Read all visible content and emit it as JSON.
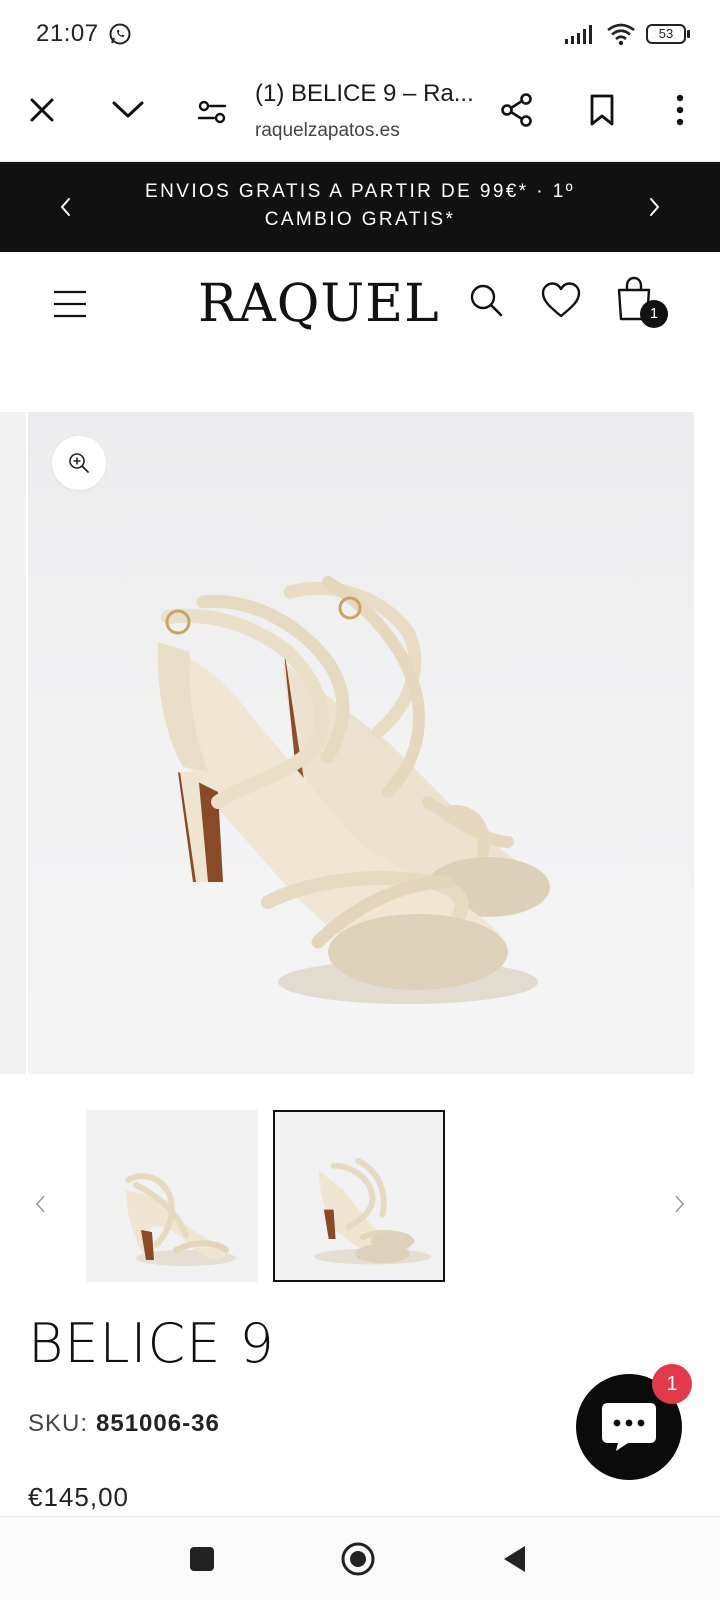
{
  "status_bar": {
    "time": "21:07",
    "battery": "53"
  },
  "browser": {
    "tab_title": "(1) BELICE 9 – Ra...",
    "url": "raquelzapatos.es"
  },
  "announcement": {
    "text": "ENVIOS GRATIS A PARTIR DE 99€* · 1º CAMBIO GRATIS*"
  },
  "store": {
    "logo": "RAQUEL",
    "cart_count": "1"
  },
  "product": {
    "title": "BELICE 9",
    "sku_label": "SKU:",
    "sku_value": "851006-36",
    "price": "€145,00"
  },
  "chat": {
    "badge_count": "1"
  },
  "colors": {
    "accent_black": "#111111",
    "badge_red": "#e23a4a",
    "shoe_beige": "#e7dcc6"
  }
}
